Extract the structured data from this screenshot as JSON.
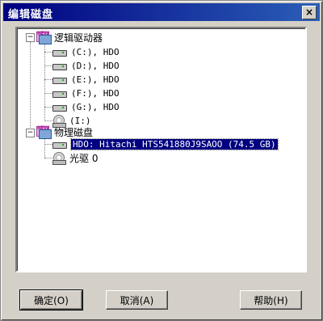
{
  "window": {
    "title": "编辑磁盘",
    "close_label": "×"
  },
  "tree": {
    "groups": [
      {
        "label": "逻辑驱动器",
        "icon": "drive-group-icon",
        "expanded": true,
        "children": [
          {
            "label": "(C:), HDO",
            "icon": "hard-disk-icon"
          },
          {
            "label": "(D:), HDO",
            "icon": "hard-disk-icon"
          },
          {
            "label": "(E:), HDO",
            "icon": "hard-disk-icon"
          },
          {
            "label": "(F:), HDO",
            "icon": "hard-disk-icon"
          },
          {
            "label": "(G:), HDO",
            "icon": "hard-disk-icon"
          },
          {
            "label": "(I:)",
            "icon": "cd-drive-icon"
          }
        ]
      },
      {
        "label": "物理磁盘",
        "icon": "drive-group-icon",
        "expanded": true,
        "children": [
          {
            "label": "HDO: Hitachi HTS541880J9SAOO (74.5 GB)",
            "icon": "hard-disk-icon",
            "selected": true
          },
          {
            "label": "光驱 0",
            "icon": "cd-drive-icon"
          }
        ]
      }
    ]
  },
  "buttons": {
    "ok": "确定(O)",
    "cancel": "取消(A)",
    "help": "帮助(H)"
  },
  "colors": {
    "titlebar": "#000080",
    "selection": "#000080",
    "face": "#d4d0c8"
  }
}
